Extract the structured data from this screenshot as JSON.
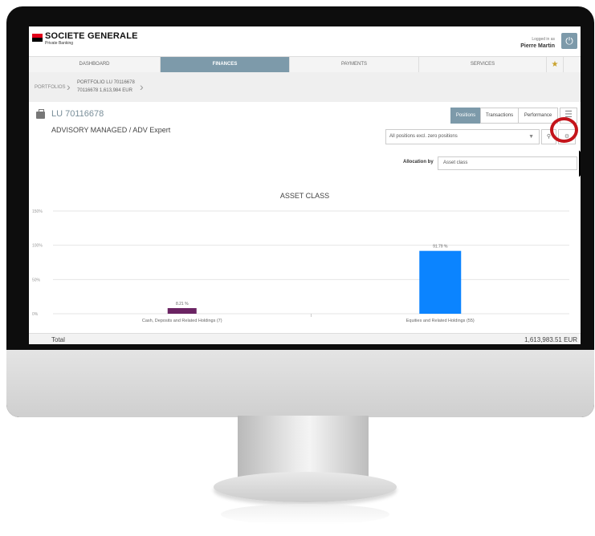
{
  "brand": {
    "name": "SOCIETE GENERALE",
    "subtitle": "Private Banking",
    "colors": {
      "red": "#e2001a",
      "black": "#000000"
    }
  },
  "user": {
    "logged_label": "Logged in as",
    "name": "Pierre Martin",
    "power_icon": "power-icon"
  },
  "nav": {
    "tabs": [
      {
        "label": "DASHBOARD",
        "active": false
      },
      {
        "label": "FINANCES",
        "active": true
      },
      {
        "label": "PAYMENTS",
        "active": false
      },
      {
        "label": "SERVICES",
        "active": false
      }
    ],
    "star_icon": "star-icon",
    "accent": "#7d9aaa"
  },
  "breadcrumb": {
    "root": "PORTFOLIOS",
    "title": "PORTFOLIO LU 70116678",
    "subtitle": "70116678 1,613,984 EUR"
  },
  "portfolio": {
    "id": "LU 70116678",
    "mandate": "ADVISORY MANAGED / ADV Expert"
  },
  "view_tabs": [
    {
      "label": "Positions",
      "active": true
    },
    {
      "label": "Transactions",
      "active": false
    },
    {
      "label": "Performance",
      "active": false
    }
  ],
  "filter": {
    "value": "All positions excl. zero positions",
    "search_icon": "search-icon",
    "settings_icon": "settings-icon"
  },
  "allocation": {
    "label": "Allocation by",
    "value": "Asset class"
  },
  "chart_data": {
    "type": "bar",
    "title": "ASSET CLASS",
    "categories": [
      "Cash, Deposits and Related Holdings (7)",
      "Equities and Related Holdings (55)"
    ],
    "values": [
      8.21,
      91.79
    ],
    "value_labels": [
      "8.21 %",
      "91.79 %"
    ],
    "colors": [
      "#6b2463",
      "#0b84ff"
    ],
    "y_ticks": [
      "0%",
      "50%",
      "100%",
      "150%"
    ],
    "ylim": [
      0,
      150
    ],
    "grid": true
  },
  "total": {
    "label": "Total",
    "value": "1,613,983.51 EUR"
  }
}
